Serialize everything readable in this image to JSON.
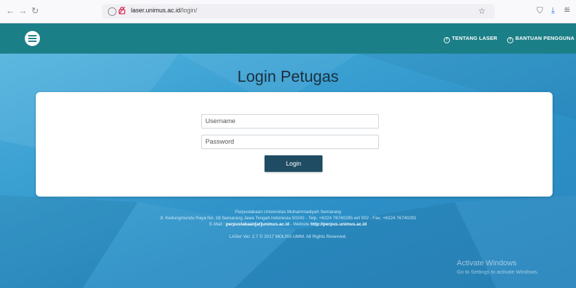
{
  "browser": {
    "url_host": "laser.unimus.ac.id",
    "url_path": "/login/"
  },
  "header": {
    "about_link": "TENTANG LASER",
    "help_link": "BANTUAN PENGGUNA"
  },
  "page": {
    "title": "Login Petugas"
  },
  "form": {
    "username_placeholder": "Username",
    "password_placeholder": "Password",
    "login_label": "Login"
  },
  "footer": {
    "line1": "Perpustakaan Universitas Muhammadiyah Semarang",
    "line2": "Jl. Kedungmundu Raya No. 18 Semarang Jawa Tengah Indonesia 50242 - Telp. +6224 76740295 ext 502 - Fax. +6224 76740291",
    "email_label": "E-Mail :",
    "email": "perpustakaan[at]unimus.ac.id",
    "website_label": "- Website",
    "website": "http://perpus.unimus.ac.id",
    "version": "LASer Ver. 2.7 © 2017 MOLRG-UMM. All Rights Reserved."
  },
  "watermark": {
    "title": "Activate Windows",
    "subtitle": "Go to Settings to activate Windows."
  },
  "colors": {
    "header": "#1b7f87",
    "background": "#3aa0d2",
    "button": "#1f4c63",
    "title_text": "#1c2f3e"
  },
  "icons": {
    "back": "arrow-left",
    "forward": "arrow-right",
    "reload": "reload",
    "shield": "shield",
    "lock": "insecure-lock",
    "bookmark": "star",
    "pocket": "pocket",
    "download": "download",
    "extensions": "extensions",
    "menu": "hamburger",
    "info": "question-circle"
  }
}
